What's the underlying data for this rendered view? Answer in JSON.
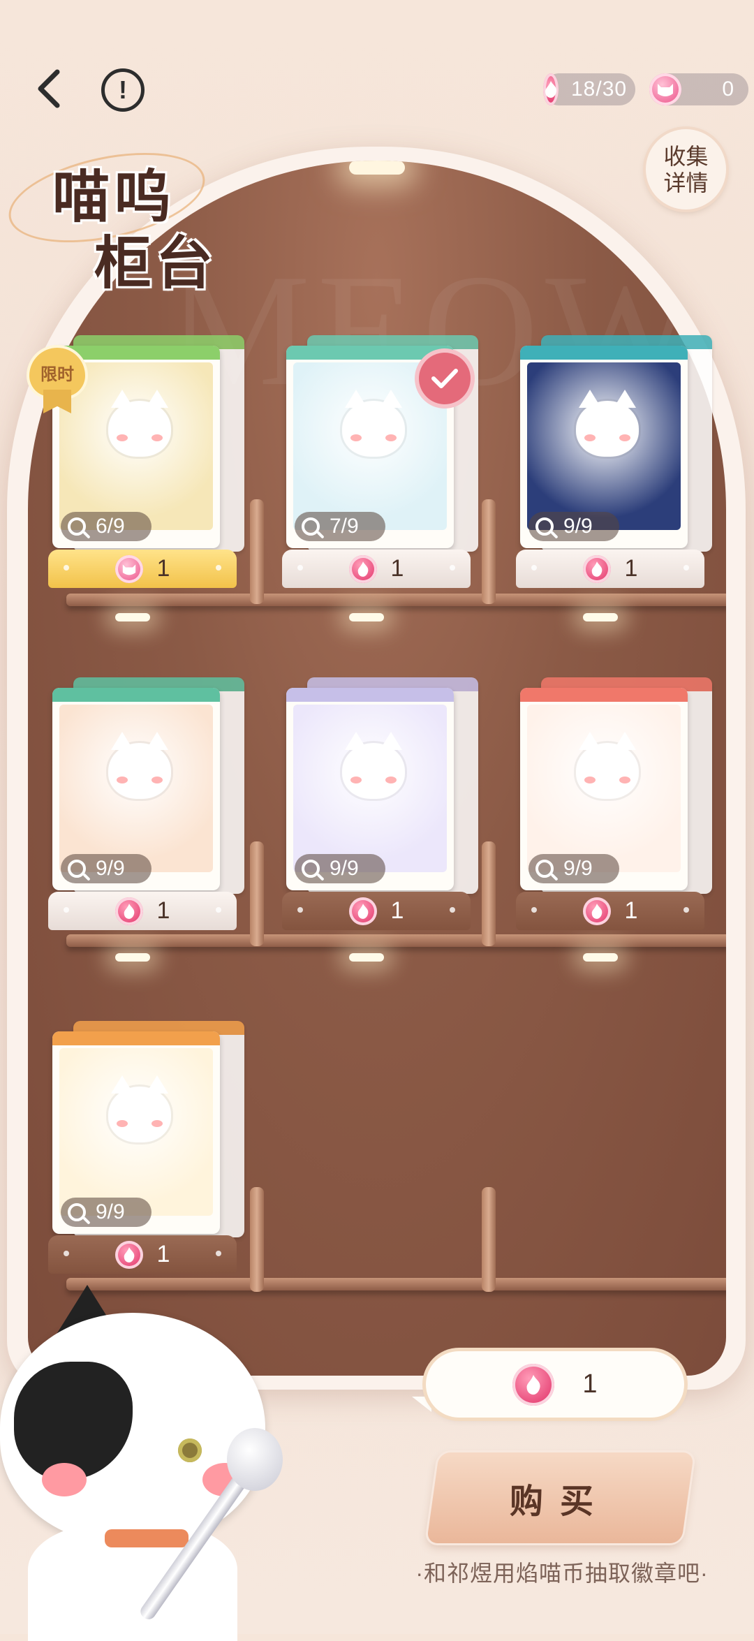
{
  "header": {
    "flame_coin_balance": "18/30",
    "cat_coin_balance": "0",
    "title_line1": "喵呜",
    "title_line2": "柜台",
    "collect_label_line1": "收集",
    "collect_label_line2": "详情",
    "watermark": "MEOW"
  },
  "limited_badge": "限时",
  "items": [
    {
      "progress": "6/9",
      "price": "1",
      "currency": "cat-coin",
      "band": "#8ccf6a",
      "art_bg": "#f6e7b8",
      "tag": "gold"
    },
    {
      "progress": "7/9",
      "price": "1",
      "currency": "flame-coin",
      "band": "#6cc9b0",
      "art_bg": "#dff2f7",
      "tag": "light",
      "selected": true
    },
    {
      "progress": "9/9",
      "price": "1",
      "currency": "flame-coin",
      "band": "#3fb0b8",
      "art_bg": "#2c3e7a",
      "tag": "light"
    },
    {
      "progress": "9/9",
      "price": "1",
      "currency": "flame-coin",
      "band": "#5fc0a0",
      "art_bg": "#fbe4d2",
      "tag": "light"
    },
    {
      "progress": "9/9",
      "price": "1",
      "currency": "flame-coin",
      "band": "#c6bfe8",
      "art_bg": "#ece7fb",
      "tag": "dark"
    },
    {
      "progress": "9/9",
      "price": "1",
      "currency": "flame-coin",
      "band": "#f0786a",
      "art_bg": "#fff2ea",
      "tag": "dark"
    },
    {
      "progress": "9/9",
      "price": "1",
      "currency": "flame-coin",
      "band": "#f2a04c",
      "art_bg": "#fff4dc",
      "tag": "dark"
    }
  ],
  "purchase": {
    "cost": "1",
    "buy_label": "购买",
    "hint": "·和祁煜用焰喵币抽取徽章吧·"
  },
  "colors": {
    "accent_pink": "#e84a7a",
    "cabinet_brown": "#8b5a46",
    "button_peach": "#eab79a"
  }
}
